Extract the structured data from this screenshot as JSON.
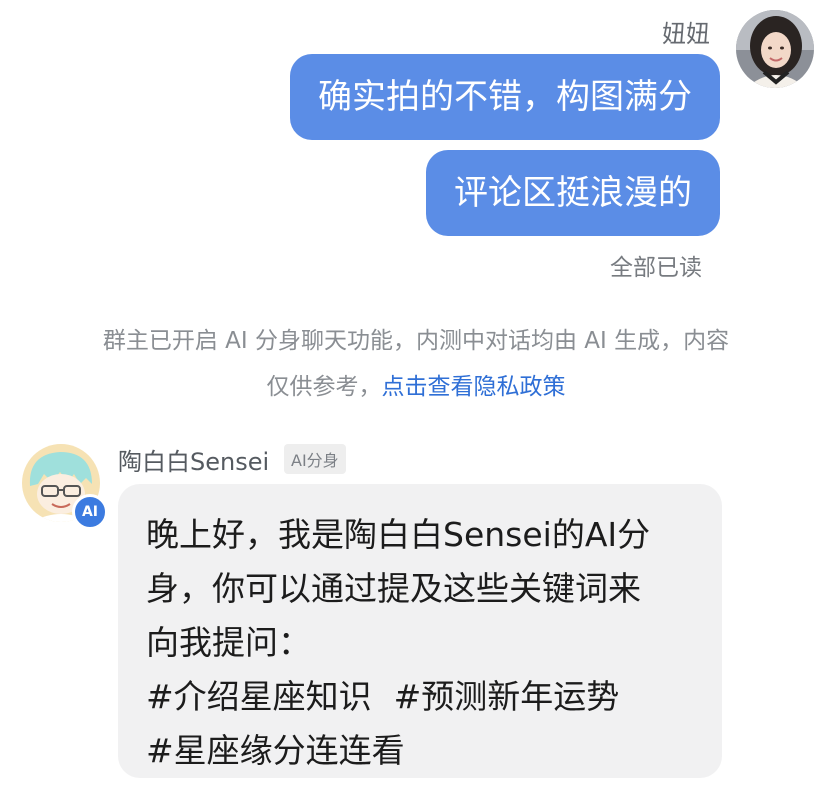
{
  "sender": {
    "name": "妞妞",
    "messages": [
      "确实拍的不错，构图满分",
      "评论区挺浪漫的"
    ],
    "read_status": "全部已读"
  },
  "notice": {
    "text": "群主已开启 AI 分身聊天功能，内测中对话均由 AI 生成，内容仅供参考，",
    "link": "点击查看隐私政策"
  },
  "bot": {
    "name": "陶白白Sensei",
    "tag": "AI分身",
    "badge": "AI",
    "message_lines": [
      "晚上好，我是陶白白Sensei的AI分",
      "身，你可以通过提及这些关键词来",
      "向我提问："
    ],
    "keywords": [
      "#介绍星座知识",
      "#预测新年运势",
      "#星座缘分连连看"
    ]
  },
  "colors": {
    "sent_bubble": "#5b8de6",
    "received_bubble": "#f1f1f2",
    "link": "#2f6fd6",
    "ai_badge": "#3c7be0"
  }
}
